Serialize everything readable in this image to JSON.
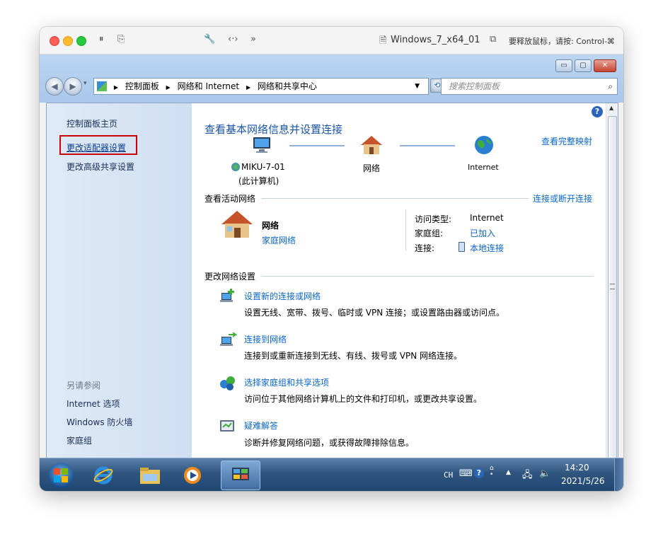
{
  "mac_toolbar": {
    "vm_name": "Windows_7_x64_01",
    "hint": "要释放鼠标，请按: Control-⌘"
  },
  "window": {
    "minimize": "▭",
    "maximize": "▢",
    "close": "✕"
  },
  "address_bar": {
    "crumbs": [
      "控制面板",
      "网络和 Internet",
      "网络和共享中心"
    ],
    "search_placeholder": "搜索控制面板"
  },
  "left_pane": {
    "home": "控制面板主页",
    "links": [
      "更改适配器设置",
      "更改高级共享设置"
    ],
    "see_also_title": "另请参阅",
    "see_also": [
      "Internet 选项",
      "Windows 防火墙",
      "家庭组"
    ]
  },
  "main": {
    "title": "查看基本网络信息并设置连接",
    "view_full_map": "查看完整映射",
    "map": {
      "computer_name": "MIKU-7-01",
      "computer_sub": "(此计算机)",
      "network": "网络",
      "internet": "Internet"
    },
    "active_title": "查看活动网络",
    "connect_disconnect": "连接或断开连接",
    "active_network": {
      "name": "网络",
      "type": "家庭网络",
      "access_label": "访问类型:",
      "access_value": "Internet",
      "homegroup_label": "家庭组:",
      "homegroup_value": "已加入",
      "connection_label": "连接:",
      "connection_value": "本地连接"
    },
    "change_title": "更改网络设置",
    "tasks": [
      {
        "title": "设置新的连接或网络",
        "desc": "设置无线、宽带、拨号、临时或 VPN 连接；或设置路由器或访问点。"
      },
      {
        "title": "连接到网络",
        "desc": "连接到或重新连接到无线、有线、拨号或 VPN 网络连接。"
      },
      {
        "title": "选择家庭组和共享选项",
        "desc": "访问位于其他网络计算机上的文件和打印机，或更改共享设置。"
      },
      {
        "title": "疑难解答",
        "desc": "诊断并修复网络问题，或获得故障排除信息。"
      }
    ]
  },
  "taskbar": {
    "lang": "CH",
    "time": "14:20",
    "date": "2021/5/26"
  },
  "colors": {
    "link": "#0b66c9",
    "title": "#1a54a6",
    "highlight_border": "#cc0000"
  }
}
